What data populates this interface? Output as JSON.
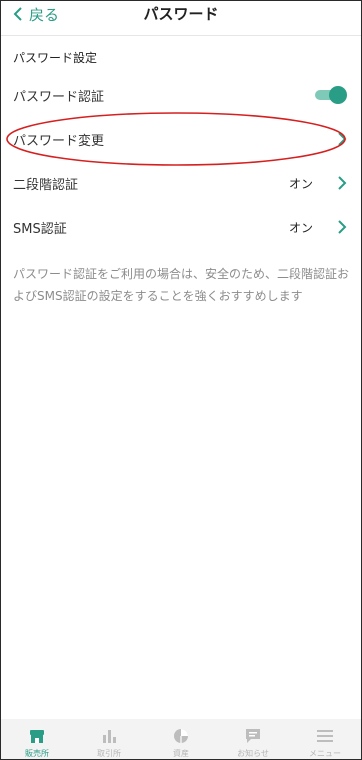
{
  "header": {
    "back_label": "戻る",
    "title": "パスワード"
  },
  "section_label": "パスワード設定",
  "rows": [
    {
      "label": "パスワード認証",
      "toggle_on": true
    },
    {
      "label": "パスワード変更"
    },
    {
      "label": "二段階認証",
      "value": "オン"
    },
    {
      "label": "SMS認証",
      "value": "オン"
    }
  ],
  "note": "パスワード認証をご利用の場合は、安全のため、二段階認証およびSMS認証の設定をすることを強くおすすめします",
  "tabbar": {
    "items": [
      {
        "label": "販売所",
        "icon": "shop-icon",
        "active": true
      },
      {
        "label": "取引所",
        "icon": "bar-chart-icon"
      },
      {
        "label": "資産",
        "icon": "pie-chart-icon"
      },
      {
        "label": "お知らせ",
        "icon": "message-icon"
      },
      {
        "label": "メニュー",
        "icon": "menu-icon"
      }
    ]
  },
  "colors": {
    "accent": "#2a9d86",
    "annotation": "#d62020"
  }
}
